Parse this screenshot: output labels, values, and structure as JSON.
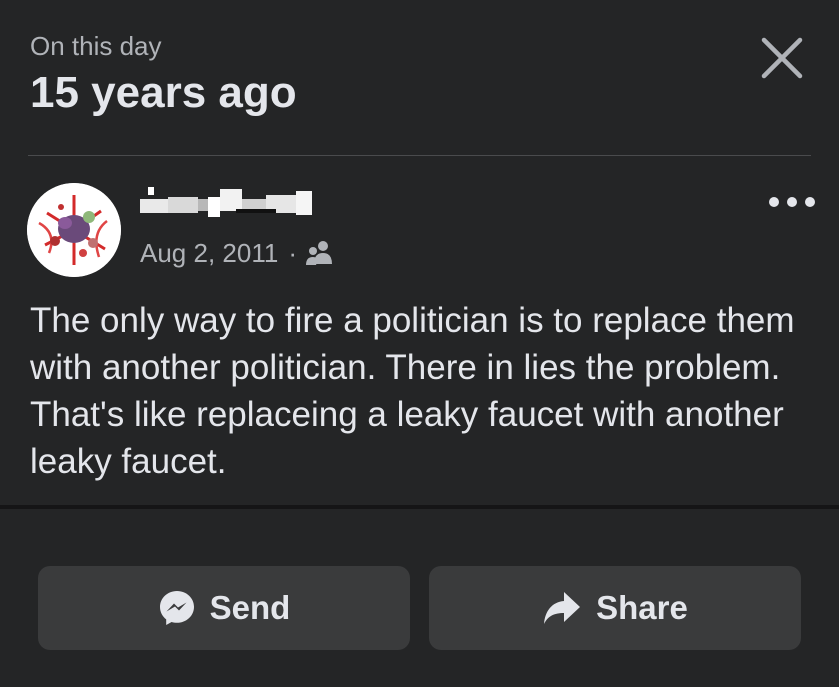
{
  "header": {
    "subtitle": "On this day",
    "title": "15 years ago"
  },
  "post": {
    "date": "Aug 2, 2011",
    "separator": "·",
    "audience_icon": "friends-icon",
    "text": "The only way to fire a politician is to replace them with another politician. There in lies the problem. That's like replaceing a leaky faucet with another leaky faucet."
  },
  "actions": {
    "send_label": "Send",
    "send_icon": "messenger-icon",
    "share_label": "Share",
    "share_icon": "share-arrow-icon"
  },
  "icons": {
    "close": "close-icon",
    "more": "more-options-icon"
  },
  "colors": {
    "background": "#242526",
    "button": "#3a3b3c",
    "primary_text": "#e4e6eb",
    "secondary_text": "#b0b3b8"
  }
}
